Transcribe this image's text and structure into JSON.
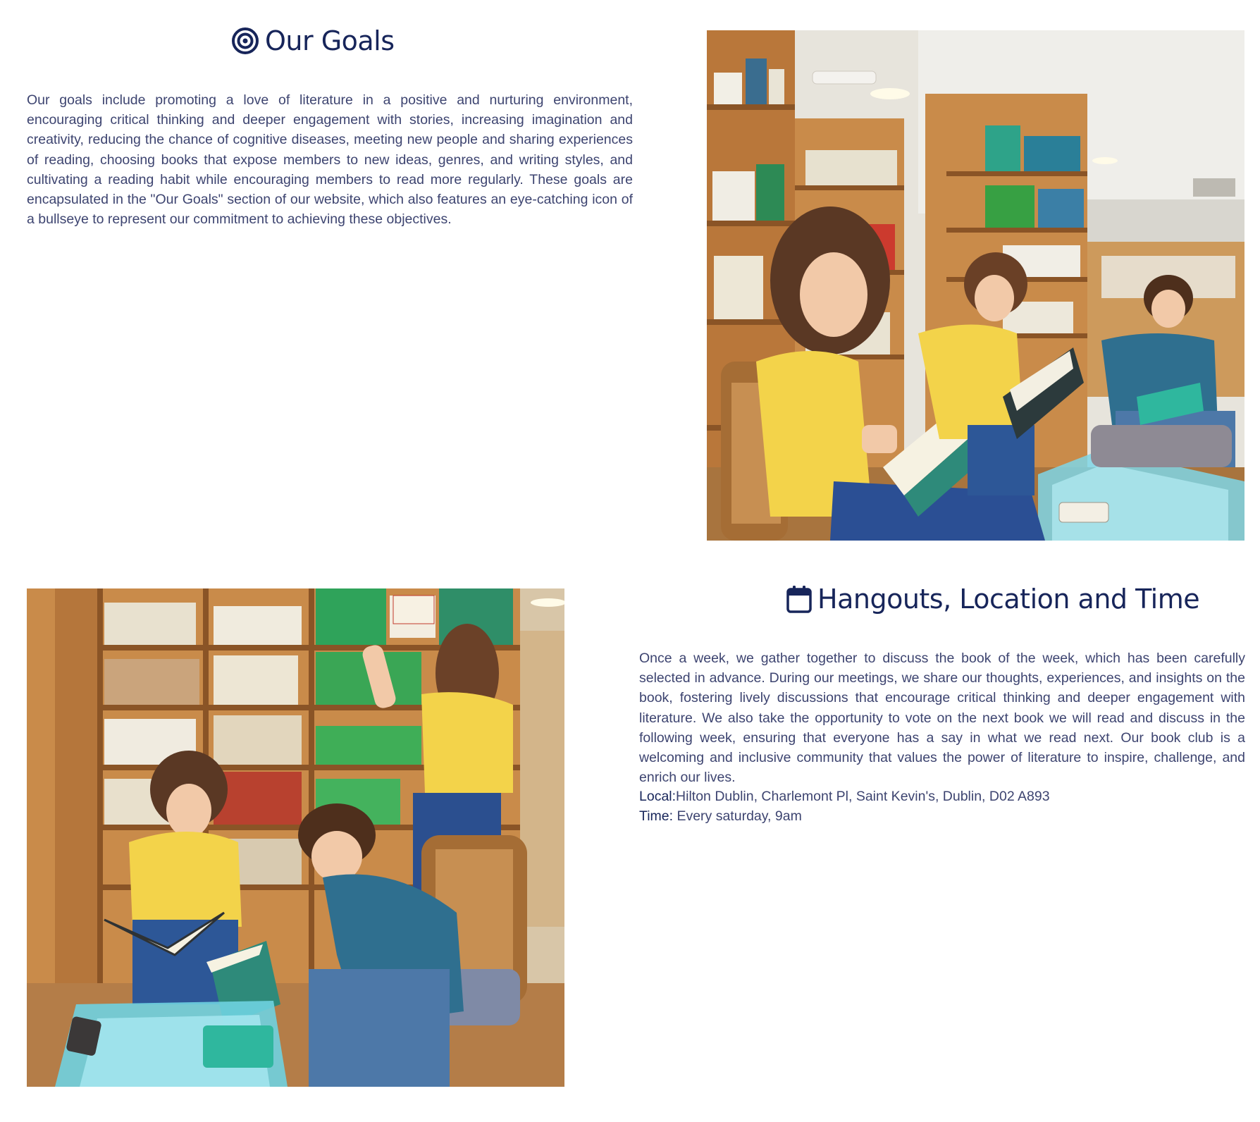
{
  "goals": {
    "icon": "bullseye-icon",
    "title": "Our Goals",
    "body": "Our goals include promoting a love of literature in a positive and nurturing environment, encouraging critical thinking and deeper engagement with stories, increasing imagination and creativity, reducing the chance of cognitive diseases, meeting new people and sharing experiences of reading, choosing books that expose members to new ideas, genres, and writing styles, and cultivating a reading habit while encouraging members to read more regularly. These goals are encapsulated in the \"Our Goals\" section of our website, which also features an eye-catching icon of a bullseye to represent our commitment to achieving these objectives."
  },
  "hangouts": {
    "icon": "calendar-icon",
    "title": "Hangouts, Location and Time",
    "body": "Once a week, we gather together to discuss the book of the week, which has been carefully selected in advance. During our meetings, we share our thoughts, experiences, and insights on the book, fostering lively discussions that encourage critical thinking and deeper engagement with literature. We also take the opportunity to vote on the next book we will read and discuss in the following week, ensuring that everyone has a say in what we read next. Our book club is a welcoming and inclusive community that values the power of literature to inspire, challenge, and enrich our lives.",
    "local_label": "Local:",
    "local_value": "Hilton Dublin, Charlemont Pl, Saint Kevin's, Dublin, D02 A893",
    "time_label": "Time:",
    "time_value": " Every saturday, 9am"
  },
  "colors": {
    "heading": "#17255a",
    "body_text": "#3d4470",
    "shirt_yellow": "#f3d34a",
    "shirt_blue": "#2f6f8f",
    "shelf_wood": "#c98b4a"
  }
}
